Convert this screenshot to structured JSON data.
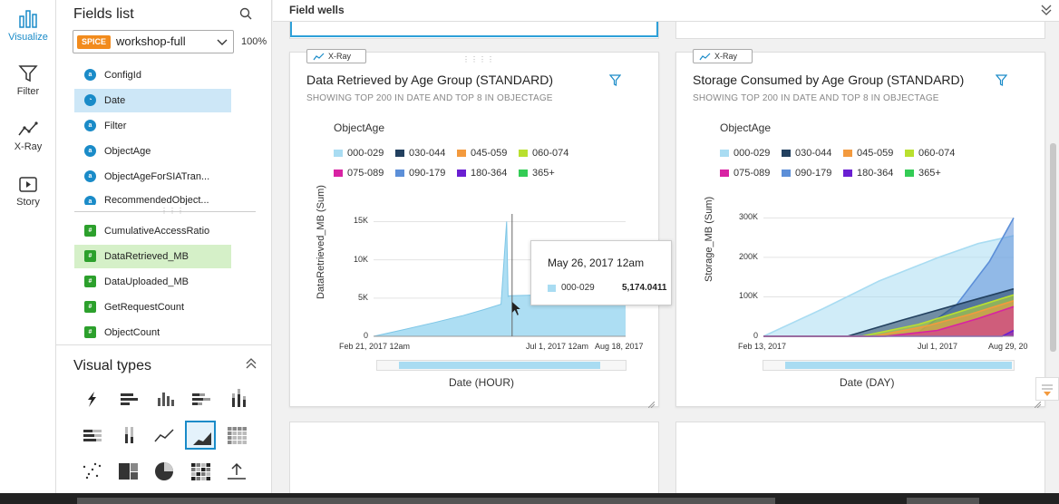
{
  "nav_rail": {
    "items": [
      {
        "label": "Visualize",
        "icon": "bar-chart-icon"
      },
      {
        "label": "Filter",
        "icon": "funnel-icon"
      },
      {
        "label": "X-Ray",
        "icon": "xray-line-icon"
      },
      {
        "label": "Story",
        "icon": "story-play-icon"
      }
    ],
    "active_color": "#1a8bc8"
  },
  "fields_panel": {
    "title": "Fields list",
    "dataset_badge": "SPICE",
    "dataset_name": "workshop-full",
    "spice_usage": "100%",
    "dimensions": [
      "ConfigId",
      "Date",
      "Filter",
      "ObjectAge",
      "ObjectAgeForSIATran...",
      "RecommendedObject..."
    ],
    "measures": [
      "CumulativeAccessRatio",
      "DataRetrieved_MB",
      "DataUploaded_MB",
      "GetRequestCount",
      "ObjectCount"
    ],
    "selected_dimension": "Date",
    "selected_measure": "DataRetrieved_MB"
  },
  "visual_types": {
    "title": "Visual types",
    "icons": [
      "autograph-icon",
      "horizontal-bar-icon",
      "vertical-bar-icon",
      "horizontal-stacked-bar-icon",
      "vertical-stacked-bar-icon",
      "horizontal-100-bar-icon",
      "vertical-100-bar-icon",
      "line-chart-icon",
      "area-chart-icon",
      "pivot-table-icon",
      "scatter-plot-icon",
      "tree-map-icon",
      "pie-chart-icon",
      "heat-map-icon",
      "kpi-icon"
    ],
    "selected": "area-chart-icon"
  },
  "field_wells": {
    "title": "Field wells"
  },
  "colors": {
    "000-029": "#a9dcf2",
    "030-044": "#22405f",
    "045-059": "#f39a3e",
    "060-074": "#b9e02f",
    "075-089": "#d822a3",
    "090-179": "#5c8fd8",
    "180-364": "#6a1fd2",
    "365+": "#33cc55"
  },
  "legend_items": [
    "000-029",
    "030-044",
    "045-059",
    "060-074",
    "075-089",
    "090-179",
    "180-364",
    "365+"
  ],
  "chart_data": [
    {
      "type": "area",
      "tag": "X-Ray",
      "title": "Data Retrieved by Age Group (STANDARD)",
      "subtitle": "SHOWING TOP 200 IN DATE AND TOP 8 IN OBJECTAGE",
      "legend_title": "ObjectAge",
      "xlabel": "Date (HOUR)",
      "ylabel": "DataRetrieved_MB (Sum)",
      "x_ticks": [
        "Feb 21, 2017 12am",
        "Jul 1, 2017 12am",
        "Aug 18, 2017"
      ],
      "y_ticks": [
        "0",
        "5K",
        "10K",
        "15K"
      ],
      "ylim": [
        0,
        16000
      ],
      "xlim": [
        "2017-02-21",
        "2017-08-18"
      ],
      "series": [
        {
          "name": "000-029",
          "x": [
            "2017-02-21",
            "2017-03-15",
            "2017-04-05",
            "2017-04-25",
            "2017-05-10",
            "2017-05-22",
            "2017-05-26",
            "2017-05-27",
            "2017-05-28",
            "2017-06-20",
            "2017-07-20",
            "2017-08-18"
          ],
          "values": [
            0,
            900,
            1800,
            2700,
            3500,
            4200,
            15000,
            5200,
            5300,
            5400,
            5500,
            5600
          ]
        }
      ],
      "tooltip": {
        "title": "May 26, 2017 12am",
        "series": "000-029",
        "value": "5,174.0411"
      }
    },
    {
      "type": "area",
      "tag": "X-Ray",
      "title": "Storage Consumed by Age Group (STANDARD)",
      "subtitle": "SHOWING TOP 200 IN DATE AND TOP 8 IN OBJECTAGE",
      "legend_title": "ObjectAge",
      "xlabel": "Date (DAY)",
      "ylabel": "Storage_MB (Sum)",
      "x_ticks": [
        "Feb 13, 2017",
        "Jul 1, 2017",
        "Aug 29, 20"
      ],
      "y_ticks": [
        "0",
        "100K",
        "200K",
        "300K"
      ],
      "ylim": [
        0,
        310000
      ],
      "xlim": [
        "2017-02-13",
        "2017-08-29"
      ],
      "series": [
        {
          "name": "000-029",
          "x": [
            "2017-02-13",
            "2017-04-01",
            "2017-05-15",
            "2017-07-01",
            "2017-08-01",
            "2017-08-29"
          ],
          "values": [
            0,
            70000,
            140000,
            200000,
            235000,
            255000
          ]
        },
        {
          "name": "090-179",
          "x": [
            "2017-02-13",
            "2017-05-15",
            "2017-06-15",
            "2017-07-15",
            "2017-08-10",
            "2017-08-29"
          ],
          "values": [
            0,
            0,
            10000,
            80000,
            190000,
            300000
          ]
        },
        {
          "name": "030-044",
          "x": [
            "2017-02-13",
            "2017-04-20",
            "2017-06-01",
            "2017-07-15",
            "2017-08-29"
          ],
          "values": [
            0,
            0,
            40000,
            80000,
            120000
          ]
        },
        {
          "name": "060-074",
          "x": [
            "2017-02-13",
            "2017-05-01",
            "2017-06-15",
            "2017-07-20",
            "2017-08-29"
          ],
          "values": [
            0,
            0,
            30000,
            65000,
            105000
          ]
        },
        {
          "name": "045-059",
          "x": [
            "2017-02-13",
            "2017-05-10",
            "2017-06-20",
            "2017-07-25",
            "2017-08-29"
          ],
          "values": [
            0,
            0,
            25000,
            55000,
            90000
          ]
        },
        {
          "name": "075-089",
          "x": [
            "2017-02-13",
            "2017-05-20",
            "2017-06-30",
            "2017-08-01",
            "2017-08-29"
          ],
          "values": [
            0,
            0,
            15000,
            45000,
            75000
          ]
        },
        {
          "name": "180-364",
          "x": [
            "2017-02-13",
            "2017-08-20",
            "2017-08-29"
          ],
          "values": [
            0,
            0,
            15000
          ]
        }
      ]
    }
  ]
}
